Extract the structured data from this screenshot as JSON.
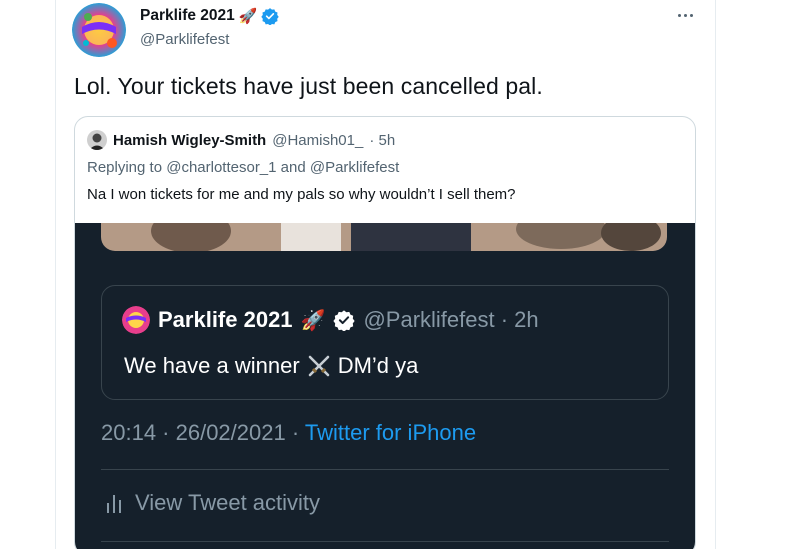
{
  "tweet": {
    "author": {
      "name": "Parklife 2021",
      "handle": "@Parklifefest",
      "emoji": "🚀"
    },
    "text": "Lol. Your tickets have just been cancelled pal."
  },
  "quoted_tweet": {
    "author": {
      "name": "Hamish Wigley-Smith",
      "handle": "@Hamish01_",
      "time": "· 5h"
    },
    "reply_context": "Replying to @charlottesor_1 and @Parklifefest",
    "text": "Na I won tickets for me and my pals so why wouldn’t I sell them?"
  },
  "screenshot": {
    "inner_quote": {
      "name": "Parklife 2021",
      "emoji": "🚀",
      "handle_time": "@Parklifefest · 2h",
      "text_before": "We have a winner",
      "text_after": "DM’d ya"
    },
    "timestamp": "20:14 · 26/02/2021 · ",
    "source": "Twitter for iPhone",
    "activity_label": "View Tweet activity"
  },
  "colors": {
    "verified": "#1d9bf0",
    "dark_bg": "#15202b",
    "link": "#1d9bf0"
  },
  "icons": [
    "verified-badge-icon",
    "rocket-icon",
    "more-icon",
    "crossed-swords-icon",
    "bar-chart-icon"
  ]
}
